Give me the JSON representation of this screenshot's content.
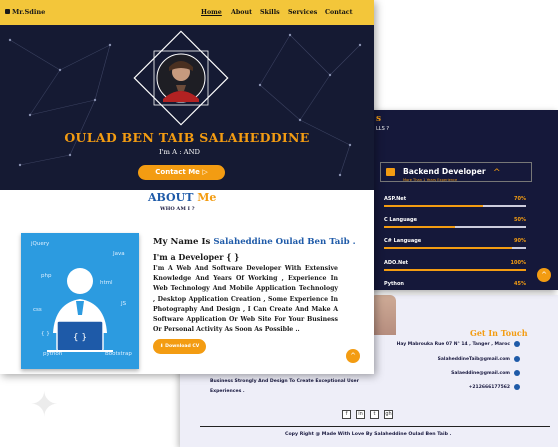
{
  "home": {
    "brand": "Mr.Sdine",
    "nav": [
      "Home",
      "About",
      "Skills",
      "Services",
      "Contact"
    ],
    "hero_title": "OULAD BEN TAIB SALAHEDDINE",
    "hero_role": "I'm A : AND",
    "contact_button": "Contact Me ▷",
    "about_heading": "ABOUT",
    "about_heading_accent": "Me",
    "about_sub": "WHO AM I ?",
    "about_name_prefix": "My Name Is",
    "about_name": "Salaheddine Oulad Ben Taib .",
    "about_role": "I'm a Developer { }",
    "about_bio": "I'm A Web And Software Developer With Extensive Knowledge And Years Of Working , Experience In Web Technology And Mobile Application Technology , Desktop Application Creation , Some Experience In Photography And Design , I Can Create And Make A Software Application Or Web Site For Your Business Or Personal Activity As Soon As Possible ..",
    "cv_button": "Download CV",
    "image_tags": [
      "jQuery",
      "Java",
      "php",
      "html",
      "JS",
      "css",
      "{ }",
      "python",
      "Bootstrap"
    ],
    "scroll_up_icon": "chevron-up-icon"
  },
  "skills": {
    "title_fragment": "s",
    "subtitle_fragment": "LLS ?",
    "group_title": "Backend Developer",
    "group_subtitle": "More Than 1 Years Experience",
    "items": [
      {
        "name": "ASP.Net",
        "pct_label": "70%",
        "level": 0.7
      },
      {
        "name": "C Language",
        "pct_label": "50%",
        "level": 0.5
      },
      {
        "name": "C# Language",
        "pct_label": "90%",
        "level": 0.9
      },
      {
        "name": "ADO.Net",
        "pct_label": "100%",
        "level": 1.0
      },
      {
        "name": "Python",
        "pct_label": "45%",
        "level": 0.45
      }
    ]
  },
  "footer": {
    "get_in_touch": "Get In Touch",
    "address": "Hay Mabrouka Rue 07 N° 14 , Tanger , Maroc",
    "email1": "SalaheddineTaib@gmail.com",
    "email2": "Salaeddine@gmail.com",
    "phone": "+212666177562",
    "text": "Business Strongly And Design To Create Exceptional User Experiences .",
    "social_labels": [
      "f",
      "in",
      "t",
      "gh"
    ],
    "copyright": "Copy Right @ Made With Love By Salaheddine Oulad Ben Taib ."
  },
  "colors": {
    "accent": "#f39c12",
    "navbar": "#f3c63a",
    "hero_bg": "#151a33",
    "blue": "#1e5aa8",
    "img_bg": "#2c9be0"
  }
}
